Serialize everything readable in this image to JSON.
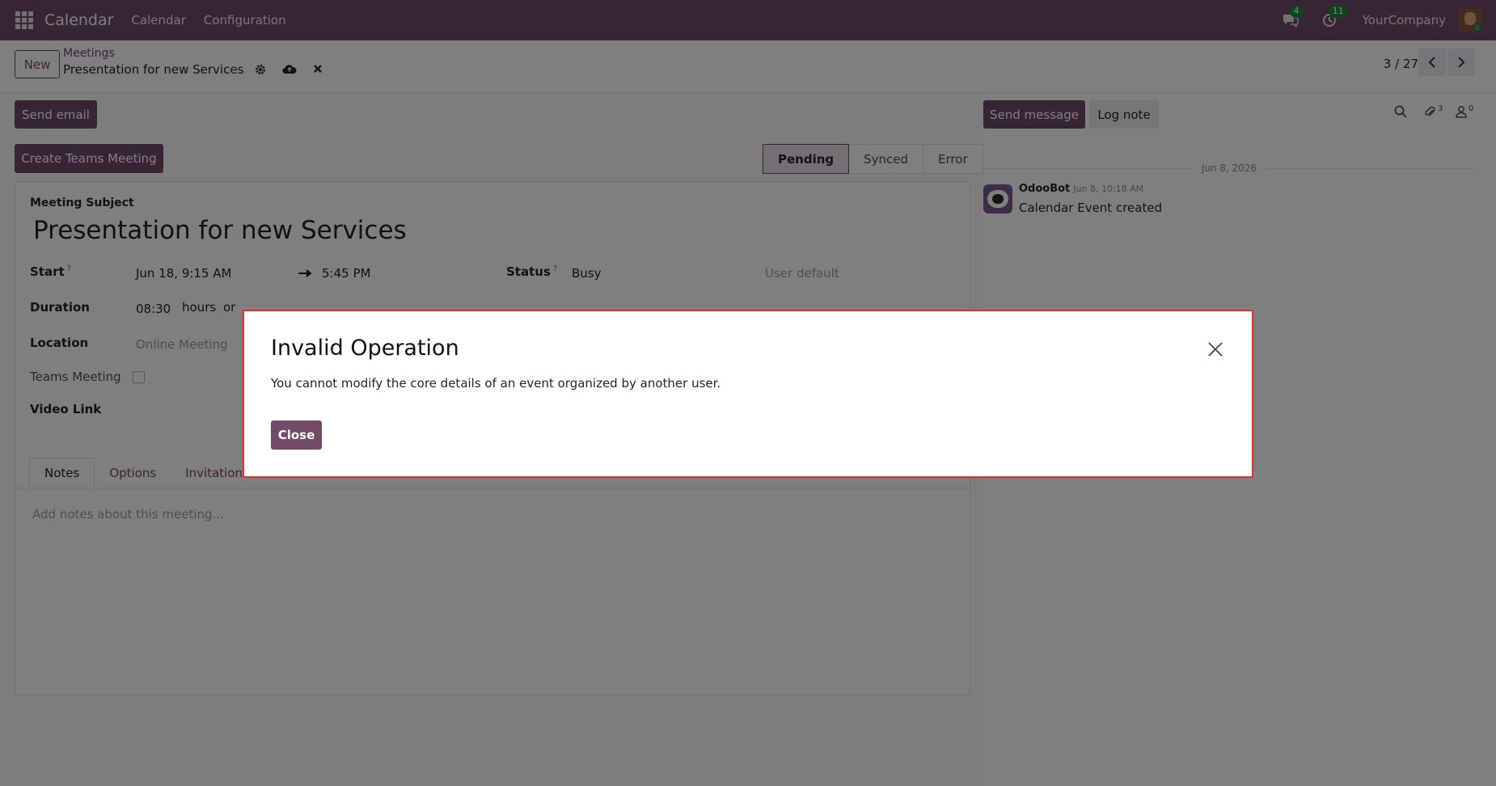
{
  "navbar": {
    "brand": "Calendar",
    "menu": [
      "Calendar",
      "Configuration"
    ],
    "messages_badge": "4",
    "activities_badge": "11",
    "company": "YourCompany"
  },
  "control_panel": {
    "new_label": "New",
    "breadcrumb_parent": "Meetings",
    "breadcrumb_current": "Presentation for new Services",
    "pager": "3 / 27"
  },
  "form": {
    "send_email_label": "Send email",
    "teams_button_label": "Create Teams Meeting",
    "stages": [
      "Pending",
      "Synced",
      "Error"
    ],
    "active_stage": "Pending",
    "subject_label": "Meeting Subject",
    "subject_value": "Presentation for new Services",
    "start_label": "Start",
    "start_help": "?",
    "start_value": "Jun 18, 9:15 AM",
    "end_value": "5:45 PM",
    "status_label": "Status",
    "status_help": "?",
    "status_value": "Busy",
    "privacy_placeholder": "User default",
    "duration_label": "Duration",
    "duration_value": "08:30",
    "hours_label": "hours",
    "or_label": "or",
    "location_label": "Location",
    "location_placeholder": "Online Meeting",
    "teams_meeting_label": "Teams Meeting",
    "video_link_label": "Video Link",
    "tabs": [
      "Notes",
      "Options",
      "Invitations"
    ],
    "notes_placeholder": "Add notes about this meeting..."
  },
  "chatter": {
    "send_message_label": "Send message",
    "log_note_label": "Log note",
    "attachments_count": "3",
    "followers_count": "0",
    "date_separator": "Jun 8, 2026",
    "message_author": "OdooBot",
    "message_time": "Jun 8, 10:18 AM",
    "message_body": "Calendar Event created"
  },
  "modal": {
    "title": "Invalid Operation",
    "body": "You cannot modify the core details of an event organized by another user.",
    "close_label": "Close"
  },
  "colors": {
    "brand": "#714B67",
    "badge": "#1d8a3e",
    "modal_border": "#e03030"
  }
}
